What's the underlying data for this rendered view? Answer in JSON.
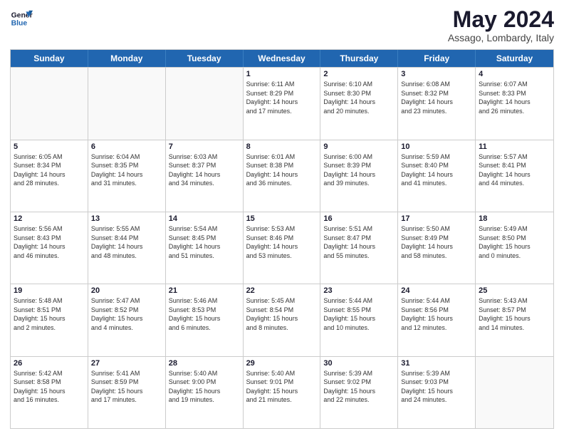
{
  "logo": {
    "line1": "General",
    "line2": "Blue"
  },
  "title": "May 2024",
  "subtitle": "Assago, Lombardy, Italy",
  "weekdays": [
    "Sunday",
    "Monday",
    "Tuesday",
    "Wednesday",
    "Thursday",
    "Friday",
    "Saturday"
  ],
  "weeks": [
    [
      {
        "day": "",
        "info": ""
      },
      {
        "day": "",
        "info": ""
      },
      {
        "day": "",
        "info": ""
      },
      {
        "day": "1",
        "info": "Sunrise: 6:11 AM\nSunset: 8:29 PM\nDaylight: 14 hours\nand 17 minutes."
      },
      {
        "day": "2",
        "info": "Sunrise: 6:10 AM\nSunset: 8:30 PM\nDaylight: 14 hours\nand 20 minutes."
      },
      {
        "day": "3",
        "info": "Sunrise: 6:08 AM\nSunset: 8:32 PM\nDaylight: 14 hours\nand 23 minutes."
      },
      {
        "day": "4",
        "info": "Sunrise: 6:07 AM\nSunset: 8:33 PM\nDaylight: 14 hours\nand 26 minutes."
      }
    ],
    [
      {
        "day": "5",
        "info": "Sunrise: 6:05 AM\nSunset: 8:34 PM\nDaylight: 14 hours\nand 28 minutes."
      },
      {
        "day": "6",
        "info": "Sunrise: 6:04 AM\nSunset: 8:35 PM\nDaylight: 14 hours\nand 31 minutes."
      },
      {
        "day": "7",
        "info": "Sunrise: 6:03 AM\nSunset: 8:37 PM\nDaylight: 14 hours\nand 34 minutes."
      },
      {
        "day": "8",
        "info": "Sunrise: 6:01 AM\nSunset: 8:38 PM\nDaylight: 14 hours\nand 36 minutes."
      },
      {
        "day": "9",
        "info": "Sunrise: 6:00 AM\nSunset: 8:39 PM\nDaylight: 14 hours\nand 39 minutes."
      },
      {
        "day": "10",
        "info": "Sunrise: 5:59 AM\nSunset: 8:40 PM\nDaylight: 14 hours\nand 41 minutes."
      },
      {
        "day": "11",
        "info": "Sunrise: 5:57 AM\nSunset: 8:41 PM\nDaylight: 14 hours\nand 44 minutes."
      }
    ],
    [
      {
        "day": "12",
        "info": "Sunrise: 5:56 AM\nSunset: 8:43 PM\nDaylight: 14 hours\nand 46 minutes."
      },
      {
        "day": "13",
        "info": "Sunrise: 5:55 AM\nSunset: 8:44 PM\nDaylight: 14 hours\nand 48 minutes."
      },
      {
        "day": "14",
        "info": "Sunrise: 5:54 AM\nSunset: 8:45 PM\nDaylight: 14 hours\nand 51 minutes."
      },
      {
        "day": "15",
        "info": "Sunrise: 5:53 AM\nSunset: 8:46 PM\nDaylight: 14 hours\nand 53 minutes."
      },
      {
        "day": "16",
        "info": "Sunrise: 5:51 AM\nSunset: 8:47 PM\nDaylight: 14 hours\nand 55 minutes."
      },
      {
        "day": "17",
        "info": "Sunrise: 5:50 AM\nSunset: 8:49 PM\nDaylight: 14 hours\nand 58 minutes."
      },
      {
        "day": "18",
        "info": "Sunrise: 5:49 AM\nSunset: 8:50 PM\nDaylight: 15 hours\nand 0 minutes."
      }
    ],
    [
      {
        "day": "19",
        "info": "Sunrise: 5:48 AM\nSunset: 8:51 PM\nDaylight: 15 hours\nand 2 minutes."
      },
      {
        "day": "20",
        "info": "Sunrise: 5:47 AM\nSunset: 8:52 PM\nDaylight: 15 hours\nand 4 minutes."
      },
      {
        "day": "21",
        "info": "Sunrise: 5:46 AM\nSunset: 8:53 PM\nDaylight: 15 hours\nand 6 minutes."
      },
      {
        "day": "22",
        "info": "Sunrise: 5:45 AM\nSunset: 8:54 PM\nDaylight: 15 hours\nand 8 minutes."
      },
      {
        "day": "23",
        "info": "Sunrise: 5:44 AM\nSunset: 8:55 PM\nDaylight: 15 hours\nand 10 minutes."
      },
      {
        "day": "24",
        "info": "Sunrise: 5:44 AM\nSunset: 8:56 PM\nDaylight: 15 hours\nand 12 minutes."
      },
      {
        "day": "25",
        "info": "Sunrise: 5:43 AM\nSunset: 8:57 PM\nDaylight: 15 hours\nand 14 minutes."
      }
    ],
    [
      {
        "day": "26",
        "info": "Sunrise: 5:42 AM\nSunset: 8:58 PM\nDaylight: 15 hours\nand 16 minutes."
      },
      {
        "day": "27",
        "info": "Sunrise: 5:41 AM\nSunset: 8:59 PM\nDaylight: 15 hours\nand 17 minutes."
      },
      {
        "day": "28",
        "info": "Sunrise: 5:40 AM\nSunset: 9:00 PM\nDaylight: 15 hours\nand 19 minutes."
      },
      {
        "day": "29",
        "info": "Sunrise: 5:40 AM\nSunset: 9:01 PM\nDaylight: 15 hours\nand 21 minutes."
      },
      {
        "day": "30",
        "info": "Sunrise: 5:39 AM\nSunset: 9:02 PM\nDaylight: 15 hours\nand 22 minutes."
      },
      {
        "day": "31",
        "info": "Sunrise: 5:39 AM\nSunset: 9:03 PM\nDaylight: 15 hours\nand 24 minutes."
      },
      {
        "day": "",
        "info": ""
      }
    ]
  ]
}
